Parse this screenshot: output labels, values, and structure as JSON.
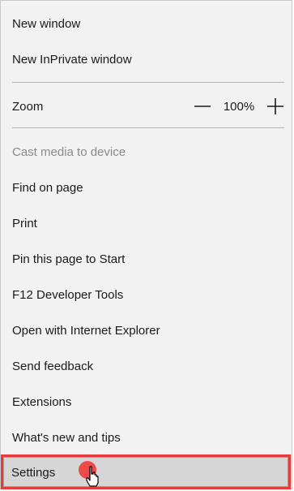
{
  "menu": {
    "new_window": "New window",
    "new_inprivate_window": "New InPrivate window",
    "zoom": {
      "label": "Zoom",
      "value": "100%",
      "minus_icon": "minus-icon",
      "plus_icon": "plus-icon"
    },
    "cast_media": "Cast media to device",
    "find_on_page": "Find on page",
    "print": "Print",
    "pin_to_start": "Pin this page to Start",
    "developer_tools": "F12 Developer Tools",
    "open_with_ie": "Open with Internet Explorer",
    "send_feedback": "Send feedback",
    "extensions": "Extensions",
    "whats_new": "What's new and tips",
    "settings": "Settings"
  },
  "colors": {
    "highlight": "#e63b3b",
    "menu_bg": "#f2f2f2",
    "hover_bg": "#d6d6d6"
  }
}
